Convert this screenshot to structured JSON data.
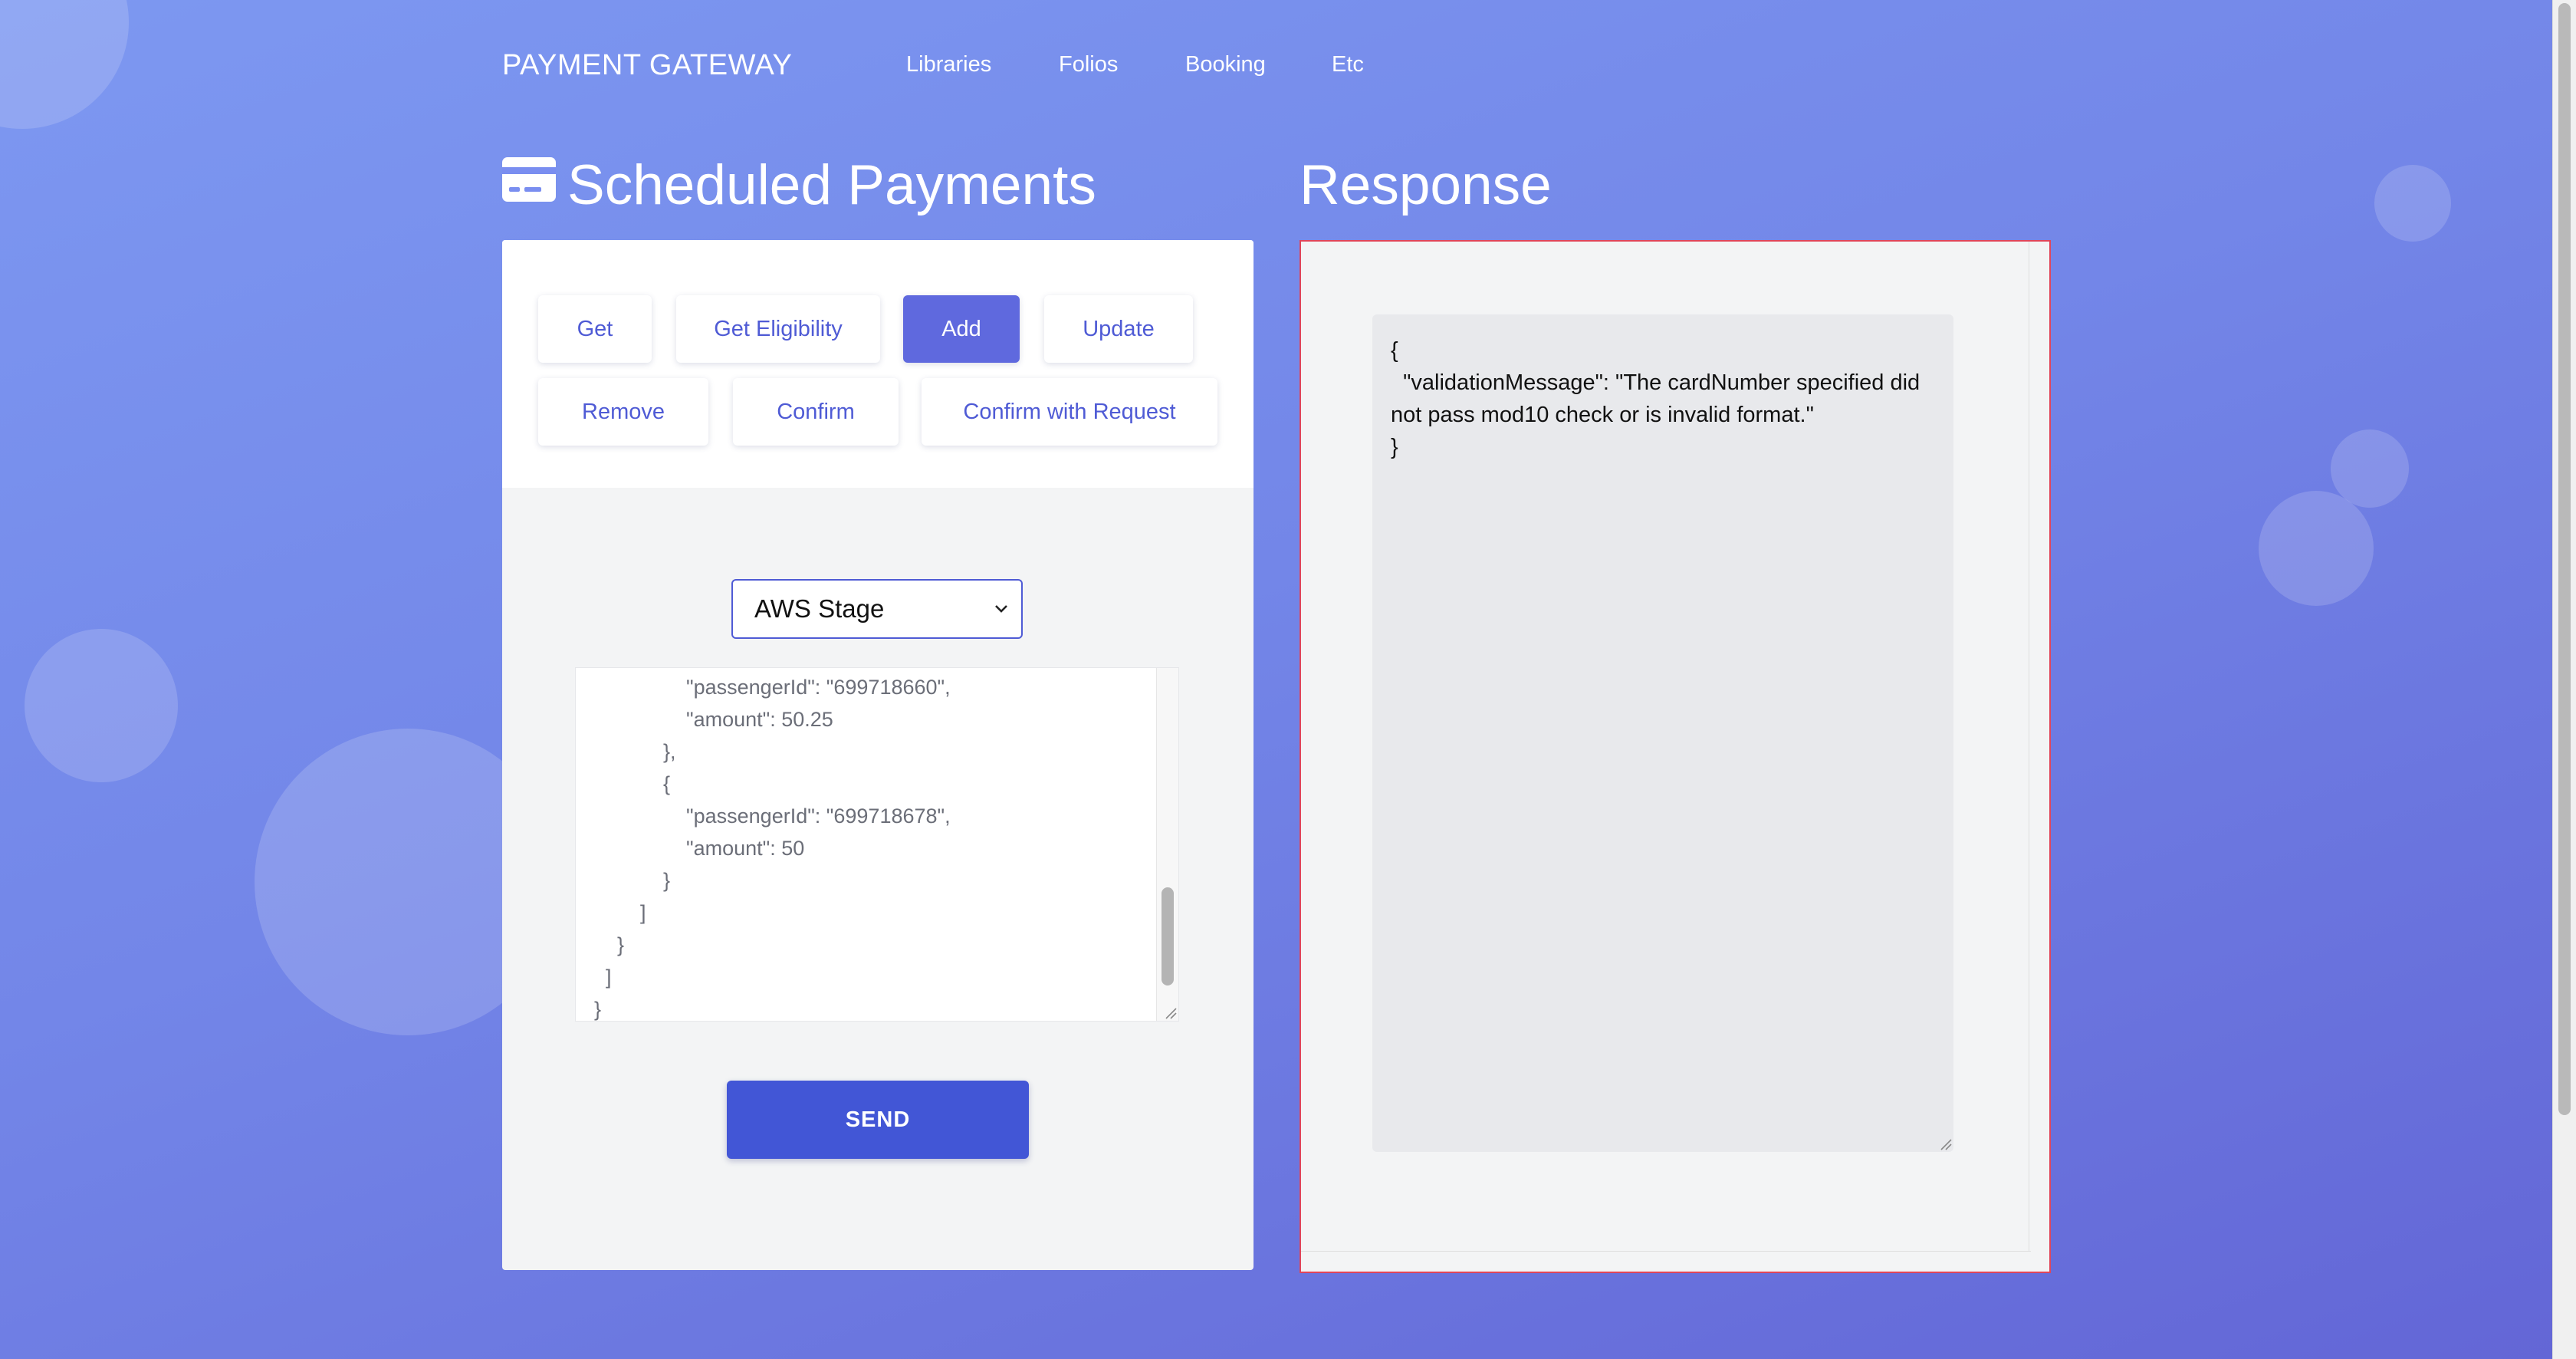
{
  "header": {
    "brand": "PAYMENT GATEWAY",
    "nav": [
      "Libraries",
      "Folios",
      "Booking",
      "Etc"
    ]
  },
  "left": {
    "title": "Scheduled Payments",
    "title_icon": "credit-card-icon",
    "operations": [
      {
        "label": "Get",
        "active": false
      },
      {
        "label": "Get Eligibility",
        "active": false
      },
      {
        "label": "Add",
        "active": true
      },
      {
        "label": "Update",
        "active": false
      },
      {
        "label": "Remove",
        "active": false
      },
      {
        "label": "Confirm",
        "active": false
      },
      {
        "label": "Confirm with Request",
        "active": false
      }
    ],
    "environment": {
      "selected": "AWS Stage"
    },
    "request_body_visible": "                \"passengerId\": \"699718660\",\n                \"amount\": 50.25\n            },\n            {\n                \"passengerId\": \"699718678\",\n                \"amount\": 50\n            }\n        ]\n    }\n  ]\n}",
    "send_label": "SEND"
  },
  "right": {
    "title": "Response",
    "response_lines": [
      "{",
      "  \"validationMessage\": \"The cardNumber specified did not pass mod10 check or is invalid format.\"",
      "}"
    ]
  },
  "colors": {
    "accent": "#4256d6",
    "active_button": "#5f69de",
    "error_border": "#e0455a"
  }
}
